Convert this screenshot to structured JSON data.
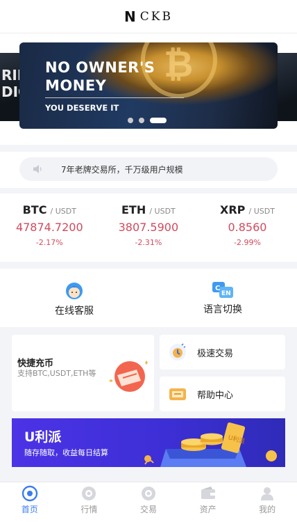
{
  "header": {
    "logo_mark": "N",
    "brand": "CKB"
  },
  "banner": {
    "line1": "NO OWNER'S",
    "line2": "MONEY",
    "line3": "YOU DESERVE IT",
    "left_peek_text": "RIN\nDIG",
    "slide_count": 3,
    "active_slide": 3
  },
  "notice": {
    "text": "7年老牌交易所，千万级用户规模",
    "icon": "speaker-icon"
  },
  "tickers": [
    {
      "symbol": "BTC",
      "quote": "/ USDT",
      "price": "47874.7200",
      "change": "-2.17%"
    },
    {
      "symbol": "ETH",
      "quote": "/ USDT",
      "price": "3807.5900",
      "change": "-2.31%"
    },
    {
      "symbol": "XRP",
      "quote": "/ USDT",
      "price": "0.8560",
      "change": "-2.99%"
    }
  ],
  "quick": {
    "support": {
      "label": "在线客服",
      "icon": "customer-service-icon"
    },
    "language": {
      "label": "语言切换",
      "icon": "language-switch-icon",
      "badge_c": "C",
      "badge_en": "EN"
    }
  },
  "cards": {
    "recharge": {
      "title": "快捷充币",
      "subtitle": "支持BTC,USDT,ETH等",
      "icon": "wallet-coin-icon"
    },
    "fast_trade": {
      "label": "极速交易",
      "icon": "fast-trade-icon"
    },
    "help": {
      "label": "帮助中心",
      "icon": "help-center-icon"
    }
  },
  "promo": {
    "title": "U利派",
    "subtitle": "随存随取，收益每日结算",
    "ticket_text": "U利派"
  },
  "nav": [
    {
      "label": "首页",
      "icon": "home-icon",
      "active": true
    },
    {
      "label": "行情",
      "icon": "market-icon",
      "active": false
    },
    {
      "label": "交易",
      "icon": "trade-icon",
      "active": false
    },
    {
      "label": "资产",
      "icon": "assets-icon",
      "active": false
    },
    {
      "label": "我的",
      "icon": "profile-icon",
      "active": false
    }
  ],
  "colors": {
    "accent": "#3b7cf0",
    "down": "#d04a5e",
    "promo": "#4c33e6"
  }
}
